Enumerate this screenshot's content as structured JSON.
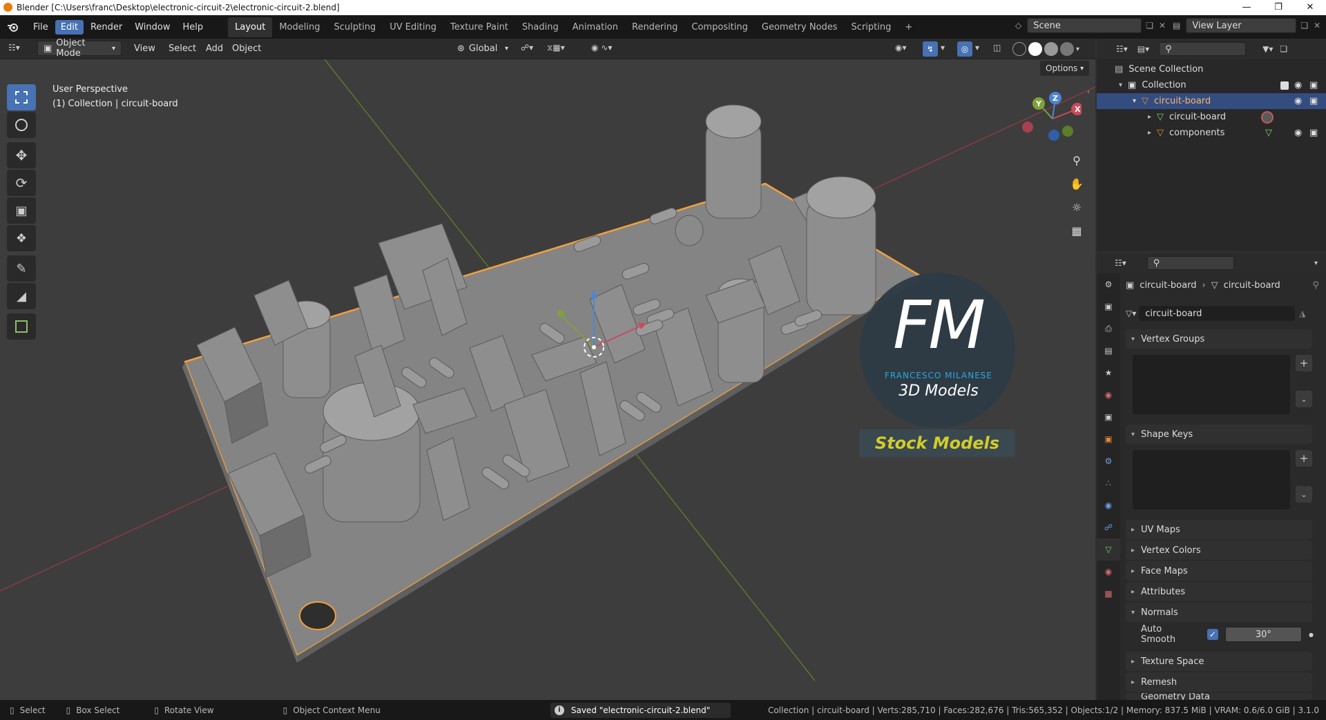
{
  "window": {
    "title": "Blender [C:\\Users\\franc\\Desktop\\electronic-circuit-2\\electronic-circuit-2.blend]",
    "controls": [
      "—",
      "❐",
      "✕"
    ]
  },
  "menu": {
    "items": [
      "File",
      "Edit",
      "Render",
      "Window",
      "Help"
    ],
    "active": "Edit"
  },
  "workspaces": {
    "tabs": [
      "Layout",
      "Modeling",
      "Sculpting",
      "UV Editing",
      "Texture Paint",
      "Shading",
      "Animation",
      "Rendering",
      "Compositing",
      "Geometry Nodes",
      "Scripting",
      "+"
    ],
    "active": "Layout"
  },
  "scene": {
    "scene_name": "Scene",
    "view_layer": "View Layer"
  },
  "viewport_header": {
    "mode": "Object Mode",
    "menus": [
      "View",
      "Select",
      "Add",
      "Object"
    ],
    "orientation": "Global",
    "options": "Options"
  },
  "viewport": {
    "perspective": "User Perspective",
    "context": "(1) Collection | circuit-board",
    "gizmo_axes": {
      "x": "X",
      "y": "Y",
      "z": "Z"
    }
  },
  "watermark": {
    "letters": "FM",
    "name": "FRANCESCO MILANESE",
    "sub": "3D Models",
    "tag": "Stock Models"
  },
  "outliner": {
    "items": [
      {
        "label": "Scene Collection"
      },
      {
        "label": "Collection"
      },
      {
        "label": "circuit-board"
      },
      {
        "label": "circuit-board"
      },
      {
        "label": "components"
      }
    ]
  },
  "properties": {
    "breadcrumb": [
      "circuit-board",
      "circuit-board"
    ],
    "mesh_name": "circuit-board",
    "panels": {
      "vertex_groups": "Vertex Groups",
      "shape_keys": "Shape Keys",
      "uv_maps": "UV Maps",
      "vertex_colors": "Vertex Colors",
      "face_maps": "Face Maps",
      "attributes": "Attributes",
      "normals": "Normals",
      "texture_space": "Texture Space",
      "remesh": "Remesh",
      "geometry_data": "Geometry Data"
    },
    "auto_smooth": {
      "label": "Auto Smooth",
      "checked": true,
      "angle": "30°"
    }
  },
  "statusbar": {
    "hints": [
      "Select",
      "Box Select",
      "Rotate View",
      "Object Context Menu"
    ],
    "saved": "Saved \"electronic-circuit-2.blend\"",
    "stats": "Collection | circuit-board | Verts:285,710 | Faces:282,676 | Tris:565,352 | Objects:1/2 | Memory: 837.5 MiB | VRAM: 0.6/6.0 GiB | 3.1.0"
  },
  "colors": {
    "accent": "#4772b3",
    "selection_outline": "#f2a03d",
    "x_axis": "#c94b5b",
    "y_axis": "#7da33a",
    "z_axis": "#4b86d6"
  }
}
